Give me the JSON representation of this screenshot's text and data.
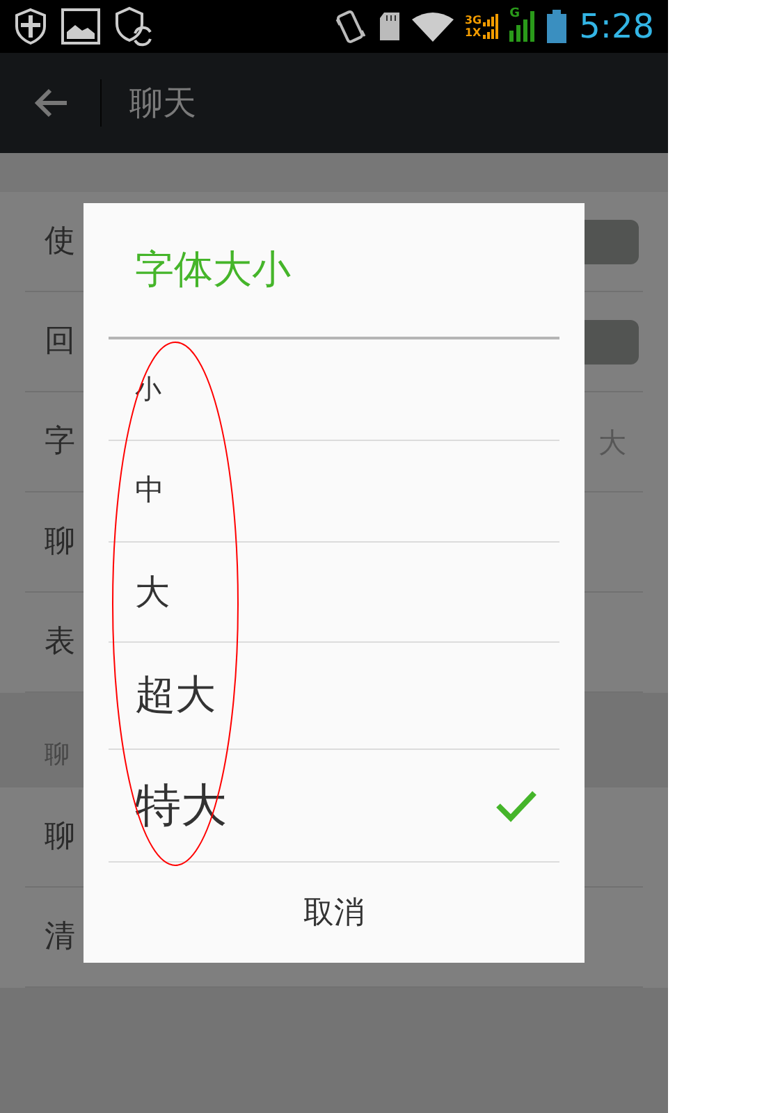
{
  "status_bar": {
    "network_labels": [
      "3G",
      "1X"
    ],
    "data_label": "G",
    "time": "5:28"
  },
  "action_bar": {
    "title": "聊天"
  },
  "settings": {
    "rows": [
      {
        "kind": "toggle",
        "label": "使",
        "on": true
      },
      {
        "kind": "toggle",
        "label": "回",
        "on": true
      },
      {
        "kind": "value",
        "label": "字",
        "value": "大"
      },
      {
        "kind": "plain",
        "label": "聊"
      },
      {
        "kind": "plain",
        "label": "表"
      },
      {
        "kind": "header",
        "label": "聊"
      },
      {
        "kind": "plain",
        "label": "聊"
      },
      {
        "kind": "plain",
        "label": "清"
      }
    ]
  },
  "dialog": {
    "title": "字体大小",
    "options": [
      {
        "label": "小",
        "selected": false
      },
      {
        "label": "中",
        "selected": false
      },
      {
        "label": "大",
        "selected": false
      },
      {
        "label": "超大",
        "selected": false
      },
      {
        "label": "特大",
        "selected": true
      }
    ],
    "cancel": "取消"
  }
}
